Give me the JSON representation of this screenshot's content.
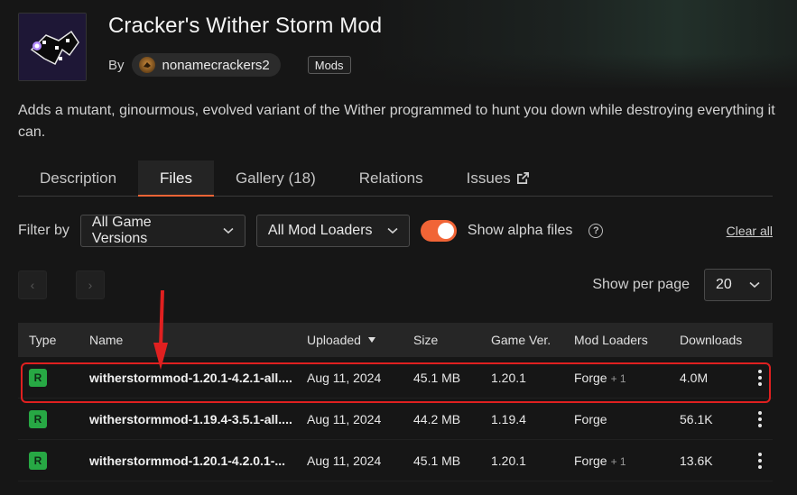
{
  "mod": {
    "title": "Cracker's Wither Storm Mod",
    "by_label": "By",
    "author": "nonamecrackers2",
    "category": "Mods",
    "description": "Adds a mutant, ginourmous, evolved variant of the Wither programmed to hunt you down while destroying everything it can."
  },
  "tabs": [
    {
      "label": "Description"
    },
    {
      "label": "Files"
    },
    {
      "label": "Gallery (18)"
    },
    {
      "label": "Relations"
    },
    {
      "label": "Issues"
    }
  ],
  "active_tab": "Files",
  "filters": {
    "label": "Filter by",
    "game_versions": "All Game Versions",
    "mod_loaders": "All Mod Loaders",
    "alpha_label": "Show alpha files",
    "alpha_enabled": true,
    "help": "?",
    "clear_all": "Clear all"
  },
  "pagination": {
    "prev": "‹",
    "next": "›",
    "per_page_label": "Show per page",
    "per_page_value": "20"
  },
  "table": {
    "headers": {
      "type": "Type",
      "name": "Name",
      "uploaded": "Uploaded",
      "size": "Size",
      "game_ver": "Game Ver.",
      "mod_loaders": "Mod Loaders",
      "downloads": "Downloads"
    },
    "rows": [
      {
        "type": "R",
        "name": "witherstormmod-1.20.1-4.2.1-all....",
        "uploaded": "Aug 11, 2024",
        "size": "45.1 MB",
        "game_ver": "1.20.1",
        "loader": "Forge",
        "loader_extra": "+ 1",
        "downloads": "4.0M"
      },
      {
        "type": "R",
        "name": "witherstormmod-1.19.4-3.5.1-all....",
        "uploaded": "Aug 11, 2024",
        "size": "44.2 MB",
        "game_ver": "1.19.4",
        "loader": "Forge",
        "loader_extra": "",
        "downloads": "56.1K"
      },
      {
        "type": "R",
        "name": "witherstormmod-1.20.1-4.2.0.1-...",
        "uploaded": "Aug 11, 2024",
        "size": "45.1 MB",
        "game_ver": "1.20.1",
        "loader": "Forge",
        "loader_extra": "+ 1",
        "downloads": "13.6K"
      }
    ]
  },
  "colors": {
    "accent": "#f16436",
    "release_badge": "#27a844",
    "highlight": "#e02020"
  },
  "icons": {
    "external_link": "external-link-icon",
    "chevron": "chevron-down-icon",
    "sort": "sort-desc-icon",
    "kebab": "kebab-menu-icon",
    "help": "help-circle-icon"
  }
}
